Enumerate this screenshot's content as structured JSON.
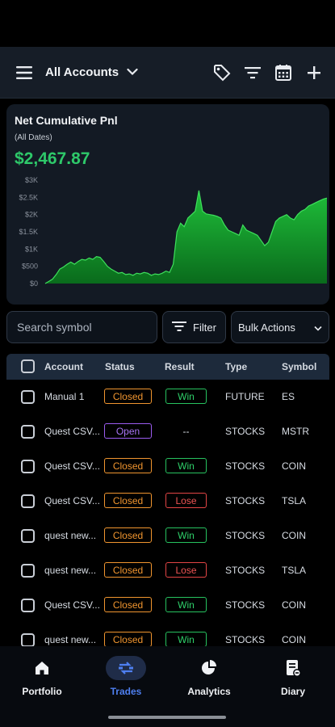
{
  "header": {
    "account_selector": "All Accounts",
    "icons": [
      "menu-icon",
      "tag-icon",
      "filter-lines-icon",
      "calendar-icon",
      "plus-icon"
    ]
  },
  "pnl": {
    "title": "Net Cumulative Pnl",
    "subtitle": "(All Dates)",
    "value": "$2,467.87",
    "value_color": "#2ec96a"
  },
  "chart_data": {
    "type": "area",
    "title": "Net Cumulative Pnl",
    "y_ticks": [
      "$3K",
      "$2.5K",
      "$2K",
      "$1.5K",
      "$1K",
      "$500",
      "$0"
    ],
    "ylim": [
      0,
      3000
    ],
    "grid": false,
    "color": "#1fbf3a",
    "series": [
      {
        "values": [
          0,
          60,
          130,
          260,
          420,
          480,
          560,
          620,
          560,
          640,
          700,
          680,
          740,
          700,
          780,
          760,
          640,
          500,
          420,
          360,
          300,
          320,
          260,
          280,
          240,
          300,
          280,
          320,
          300,
          240,
          280,
          260,
          300,
          360,
          320,
          560,
          1500,
          1750,
          1650,
          1900,
          2000,
          2100,
          2700,
          2100,
          2020,
          2000,
          1980,
          1950,
          1900,
          1700,
          1550,
          1500,
          1450,
          1400,
          1700,
          1550,
          1500,
          1450,
          1400,
          1250,
          1100,
          1200,
          1500,
          1800,
          1900,
          1950,
          2000,
          1900,
          1850,
          2000,
          2100,
          2150,
          2250,
          2300,
          2350,
          2400,
          2450,
          2480
        ]
      }
    ]
  },
  "controls": {
    "search_placeholder": "Search symbol",
    "filter_label": "Filter",
    "bulk_label": "Bulk Actions"
  },
  "table": {
    "headers": [
      "Account",
      "Status",
      "Result",
      "Type",
      "Symbol"
    ],
    "rows": [
      {
        "account": "Manual 1",
        "status": "Closed",
        "result": "Win",
        "type": "FUTURE",
        "symbol": "ES"
      },
      {
        "account": "Quest CSV...",
        "status": "Open",
        "result": "--",
        "type": "STOCKS",
        "symbol": "MSTR"
      },
      {
        "account": "Quest CSV...",
        "status": "Closed",
        "result": "Win",
        "type": "STOCKS",
        "symbol": "COIN"
      },
      {
        "account": "Quest CSV...",
        "status": "Closed",
        "result": "Lose",
        "type": "STOCKS",
        "symbol": "TSLA"
      },
      {
        "account": "quest new...",
        "status": "Closed",
        "result": "Win",
        "type": "STOCKS",
        "symbol": "COIN"
      },
      {
        "account": "quest new...",
        "status": "Closed",
        "result": "Lose",
        "type": "STOCKS",
        "symbol": "TSLA"
      },
      {
        "account": "Quest CSV...",
        "status": "Closed",
        "result": "Win",
        "type": "STOCKS",
        "symbol": "COIN"
      },
      {
        "account": "quest new...",
        "status": "Closed",
        "result": "Win",
        "type": "STOCKS",
        "symbol": "COIN"
      }
    ]
  },
  "nav": {
    "items": [
      {
        "label": "Portfolio",
        "icon": "home-icon"
      },
      {
        "label": "Trades",
        "icon": "trades-swap-icon",
        "active": true
      },
      {
        "label": "Analytics",
        "icon": "pie-chart-icon"
      },
      {
        "label": "Diary",
        "icon": "diary-icon"
      }
    ]
  },
  "colors": {
    "accent": "#4e7ff0",
    "win": "#27c25f",
    "lose": "#e24545",
    "closed": "#f0952f",
    "open": "#9b5cf0"
  }
}
